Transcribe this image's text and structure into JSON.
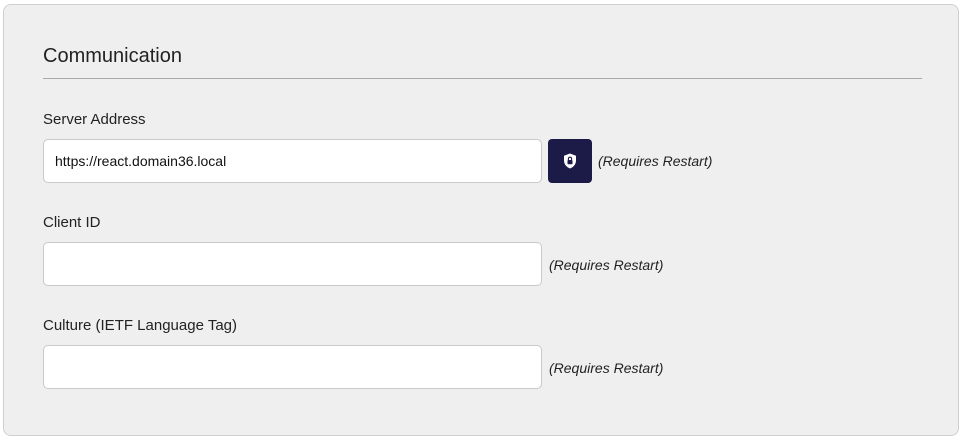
{
  "section": {
    "title": "Communication"
  },
  "fields": {
    "server_address": {
      "label": "Server Address",
      "value": "https://react.domain36.local",
      "placeholder": "",
      "note": "(Requires Restart)",
      "button_icon": "shield-lock-icon"
    },
    "client_id": {
      "label": "Client ID",
      "value": "",
      "placeholder": "",
      "note": "(Requires Restart)"
    },
    "culture": {
      "label": "Culture (IETF Language Tag)",
      "value": "",
      "placeholder": "",
      "note": "(Requires Restart)"
    }
  },
  "colors": {
    "panel_background": "#efefef",
    "button_background": "#1c1a47",
    "input_background": "#ffffff"
  }
}
